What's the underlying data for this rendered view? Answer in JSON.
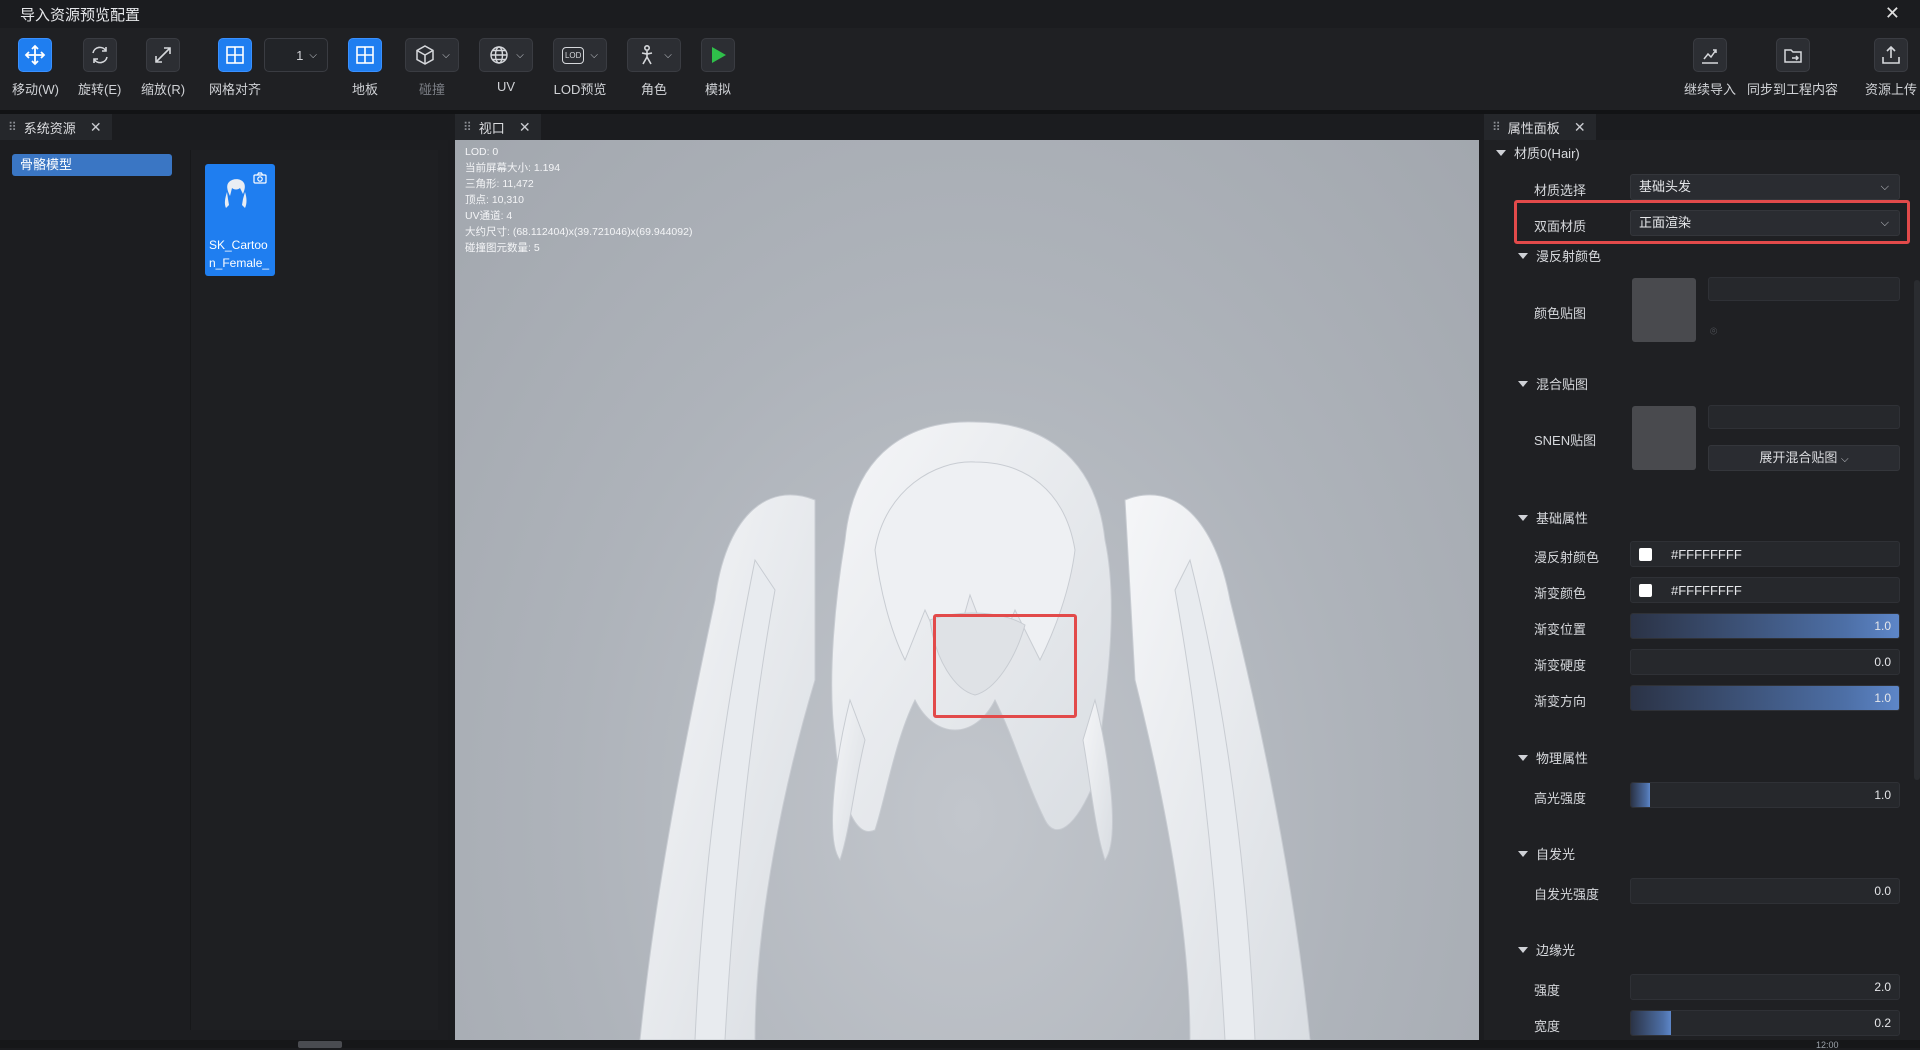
{
  "window": {
    "title": "导入资源预览配置",
    "close_icon": "close-icon"
  },
  "toolbar": {
    "move": "移动(W)",
    "rotate": "旋转(E)",
    "scale": "缩放(R)",
    "grid_snap": "网格对齐",
    "grid_value": "1",
    "floor": "地板",
    "collision": "碰撞",
    "uv": "UV",
    "lod_preview": "LOD预览",
    "lod_badge": "LOD",
    "character": "角色",
    "simulate": "模拟",
    "continue_import": "继续导入",
    "sync_project": "同步到工程内容",
    "upload": "资源上传"
  },
  "left_panel": {
    "tab": "系统资源",
    "tree_item": "骨骼模型",
    "asset_name": "SK_Cartoon_Female_"
  },
  "viewport": {
    "tab": "视口",
    "info": [
      "LOD:  0",
      "当前屏幕大小: 1.194",
      "三角形: 11,472",
      "顶点: 10,310",
      "UV通道: 4",
      "大约尺寸: (68.112404)x(39.721046)x(69.944092)",
      "碰撞图元数量: 5"
    ]
  },
  "properties": {
    "tab": "属性面板",
    "material_header": "材质0(Hair)",
    "material_select_label": "材质选择",
    "material_select_value": "基础头发",
    "double_sided_label": "双面材质",
    "double_sided_value": "正面渲染",
    "diffuse_section": "漫反射颜色",
    "color_map_label": "颜色贴图",
    "blend_section": "混合贴图",
    "snen_label": "SNEN贴图",
    "expand_blend": "展开混合贴图",
    "basic_section": "基础属性",
    "diffuse_color_label": "漫反射颜色",
    "diffuse_color_value": "#FFFFFFFF",
    "gradient_color_label": "渐变颜色",
    "gradient_color_value": "#FFFFFFFF",
    "gradient_pos_label": "渐变位置",
    "gradient_pos_value": "1.0",
    "gradient_hard_label": "渐变硬度",
    "gradient_hard_value": "0.0",
    "gradient_dir_label": "渐变方向",
    "gradient_dir_value": "1.0",
    "physics_section": "物理属性",
    "specular_label": "高光强度",
    "specular_value": "1.0",
    "emissive_section": "自发光",
    "emissive_label": "自发光强度",
    "emissive_value": "0.0",
    "rim_section": "边缘光",
    "rim_strength_label": "强度",
    "rim_strength_value": "2.0",
    "rim_width_label": "宽度",
    "rim_width_value": "0.2"
  },
  "slider_levels": {
    "gradient_pos": 1.0,
    "gradient_hard": 0.0,
    "gradient_dir": 1.0,
    "specular": 0.07,
    "emissive": 0.0,
    "rim_strength": 0.0,
    "rim_width": 0.15
  },
  "colors": {
    "accent": "#1f7ef0",
    "highlight": "#e24a4a",
    "play": "#2fbf4a"
  },
  "status": {
    "clock": "12:00"
  }
}
